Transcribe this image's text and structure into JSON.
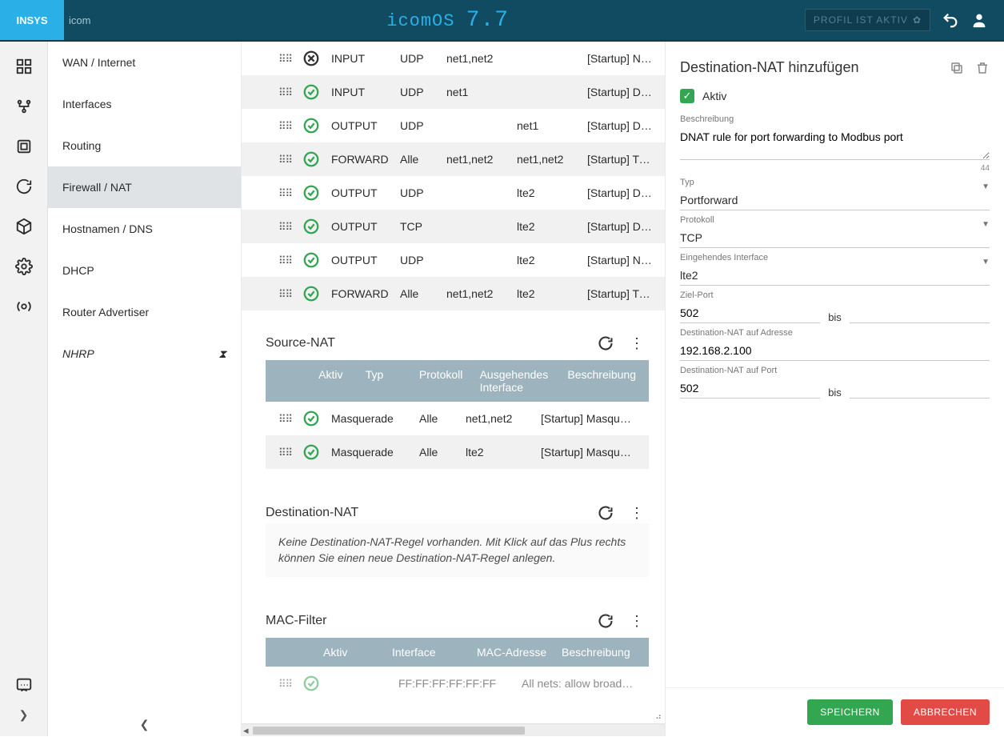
{
  "header": {
    "logo_main": "INSYS",
    "logo_suffix": "icom",
    "product": "icomOS",
    "version": "7.7",
    "profile_btn": "PROFIL IST AKTIV"
  },
  "nav": {
    "items": [
      {
        "label": "WAN / Internet"
      },
      {
        "label": "Interfaces"
      },
      {
        "label": "Routing"
      },
      {
        "label": "Firewall / NAT"
      },
      {
        "label": "Hostnamen / DNS"
      },
      {
        "label": "DHCP"
      },
      {
        "label": "Router Advertiser"
      },
      {
        "label": "NHRP"
      }
    ]
  },
  "filter_rules": [
    {
      "active": false,
      "chain": "INPUT",
      "proto": "UDP",
      "in": "net1,net2",
      "out": "",
      "desc": "[Startup] NTP queries from th..."
    },
    {
      "active": true,
      "chain": "INPUT",
      "proto": "UDP",
      "in": "net1",
      "out": "",
      "desc": "[Startup] DHCP queries from ..."
    },
    {
      "active": true,
      "chain": "OUTPUT",
      "proto": "UDP",
      "in": "",
      "out": "net1",
      "desc": "[Startup] DHCP responses to ..."
    },
    {
      "active": true,
      "chain": "FORWARD",
      "proto": "Alle",
      "in": "net1,net2",
      "out": "net1,net2",
      "desc": "[Startup] Traffic b..."
    },
    {
      "active": true,
      "chain": "OUTPUT",
      "proto": "UDP",
      "in": "",
      "out": "lte2",
      "desc": "[Startup] DNS queries sent b..."
    },
    {
      "active": true,
      "chain": "OUTPUT",
      "proto": "TCP",
      "in": "",
      "out": "lte2",
      "desc": "[Startup] DNS queries sent b..."
    },
    {
      "active": true,
      "chain": "OUTPUT",
      "proto": "UDP",
      "in": "",
      "out": "lte2",
      "desc": "[Startup] NTP queries sent by..."
    },
    {
      "active": true,
      "chain": "FORWARD",
      "proto": "Alle",
      "in": "net1,net2",
      "out": "lte2",
      "desc": "[Startup] Traffic from lo..."
    }
  ],
  "snat": {
    "title": "Source-NAT",
    "headers": {
      "aktiv": "Aktiv",
      "typ": "Typ",
      "proto": "Protokoll",
      "out": "Ausgehendes Interface",
      "desc": "Beschreibung"
    },
    "rows": [
      {
        "active": true,
        "typ": "Masquerade",
        "proto": "Alle",
        "out": "net1,net2",
        "desc": "[Startup] Masquerading for a..."
      },
      {
        "active": true,
        "typ": "Masquerade",
        "proto": "Alle",
        "out": "lte2",
        "desc": "[Startup] Masquerading for W..."
      }
    ]
  },
  "dnat": {
    "title": "Destination-NAT",
    "empty": "Keine Destination-NAT-Regel vorhanden. Mit Klick auf das Plus rechts können Sie einen neue Destination-NAT-Regel anlegen."
  },
  "mac": {
    "title": "MAC-Filter",
    "headers": {
      "aktiv": "Aktiv",
      "iface": "Interface",
      "mac": "MAC-Adresse",
      "desc": "Beschreibung"
    },
    "rows": [
      {
        "active": true,
        "iface": "",
        "mac": "FF:FF:FF:FF:FF:FF",
        "desc": "All nets: allow broadcasts"
      }
    ]
  },
  "panel": {
    "title": "Destination-NAT hinzufügen",
    "aktiv_label": "Aktiv",
    "fields": {
      "desc_label": "Beschreibung",
      "desc_value": "DNAT rule for port forwarding to Modbus port",
      "desc_count": "44",
      "typ_label": "Typ",
      "typ_value": "Portforward",
      "proto_label": "Protokoll",
      "proto_value": "TCP",
      "in_iface_label": "Eingehendes Interface",
      "in_iface_value": "lte2",
      "zielport_label": "Ziel-Port",
      "zielport_from": "502",
      "bis": "bis",
      "dnat_addr_label": "Destination-NAT auf Adresse",
      "dnat_addr_value": "192.168.2.100",
      "dnat_port_label": "Destination-NAT auf Port",
      "dnat_port_from": "502"
    },
    "save": "SPEICHERN",
    "cancel": "ABBRECHEN"
  }
}
